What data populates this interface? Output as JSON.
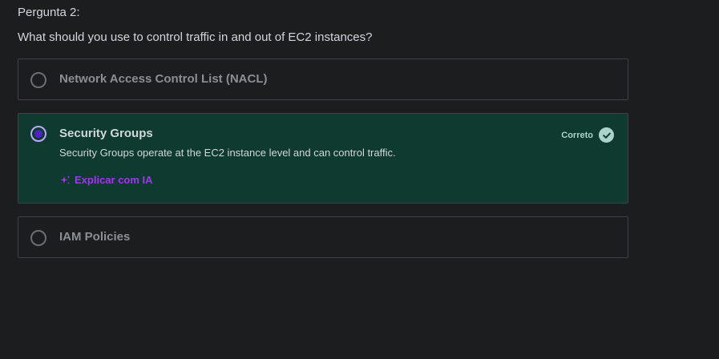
{
  "question": {
    "number_label": "Pergunta 2:",
    "text": "What should you use to control traffic in and out of EC2 instances?"
  },
  "options": [
    {
      "label": "Network Access Control List (NACL)",
      "selected": false,
      "correct": false
    },
    {
      "label": "Security Groups",
      "selected": true,
      "correct": true,
      "explanation": "Security Groups operate at the EC2 instance level and can control traffic.",
      "status_label": "Correto",
      "explain_ai_label": "Explicar com IA"
    },
    {
      "label": "IAM Policies",
      "selected": false,
      "correct": false
    }
  ],
  "icons": {
    "status": "check-circle-icon",
    "ai": "sparkle-icon"
  },
  "colors": {
    "background": "#1c1d1f",
    "correct_background": "#0e3a2f",
    "correct_accent": "#acd2cc",
    "ai_link": "#a435f0",
    "radio_selected": "#5022c3"
  }
}
